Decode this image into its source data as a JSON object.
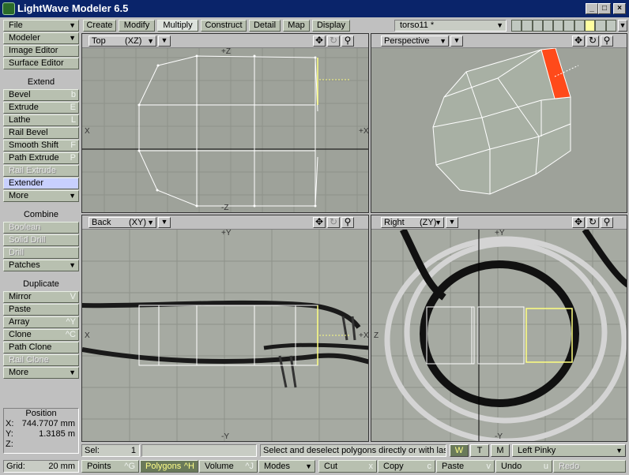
{
  "window": {
    "title": "LightWave Modeler 6.5",
    "min": "_",
    "max": "□",
    "close": "×"
  },
  "tabs": [
    "Create",
    "Modify",
    "Multiply",
    "Construct",
    "Detail",
    "Map",
    "Display"
  ],
  "object_name": "torso11 *",
  "sidebar": {
    "menus": [
      {
        "label": "File"
      },
      {
        "label": "Modeler"
      },
      {
        "label": "Image Editor"
      },
      {
        "label": "Surface Editor"
      }
    ],
    "extend_header": "Extend",
    "extend": [
      {
        "label": "Bevel",
        "shortcut": "b"
      },
      {
        "label": "Extrude",
        "shortcut": "E"
      },
      {
        "label": "Lathe",
        "shortcut": "L"
      },
      {
        "label": "Rail Bevel",
        "shortcut": ""
      },
      {
        "label": "Smooth Shift",
        "shortcut": "F"
      },
      {
        "label": "Path Extrude",
        "shortcut": "P"
      },
      {
        "label": "Rail Extrude",
        "shortcut": ""
      },
      {
        "label": "Extender",
        "shortcut": ""
      },
      {
        "label": "More",
        "shortcut": ""
      }
    ],
    "combine_header": "Combine",
    "combine": [
      {
        "label": "Boolean"
      },
      {
        "label": "Solid Drill"
      },
      {
        "label": "Drill"
      },
      {
        "label": "Patches"
      }
    ],
    "duplicate_header": "Duplicate",
    "duplicate": [
      {
        "label": "Mirror",
        "shortcut": "V"
      },
      {
        "label": "Paste",
        "shortcut": ""
      },
      {
        "label": "Array",
        "shortcut": "^Y"
      },
      {
        "label": "Clone",
        "shortcut": "^C"
      },
      {
        "label": "Path Clone",
        "shortcut": ""
      },
      {
        "label": "Rail Clone",
        "shortcut": ""
      },
      {
        "label": "More",
        "shortcut": ""
      }
    ],
    "position": {
      "label": "Position",
      "x_label": "X:",
      "x": "744.7707 mm",
      "y_label": "Y:",
      "y": "1.3185 m",
      "z_label": "Z:",
      "z": ""
    }
  },
  "viewports": {
    "top": {
      "view": "Top",
      "axes": "(XZ)",
      "axis_top": "+Z",
      "axis_bottom": "-Z",
      "axis_right": "+X",
      "axis_left": "X"
    },
    "perspective": {
      "view": "Perspective"
    },
    "back": {
      "view": "Back",
      "axes": "(XY)",
      "axis_top": "+Y",
      "axis_bottom": "-Y",
      "axis_right": "+X",
      "axis_left": "X"
    },
    "right": {
      "view": "Right",
      "axes": "(ZY)",
      "axis_top": "+Y",
      "axis_bottom": "-Y",
      "axis_left": "Z"
    }
  },
  "status": {
    "sel_label": "Sel:",
    "sel_count": "1",
    "hint": "Select and deselect polygons directly or with las...",
    "w": "W",
    "t": "T",
    "m": "M",
    "layer": "Left Pinky"
  },
  "bottom": {
    "grid_label": "Grid:",
    "grid_value": "20 mm",
    "points": "Points",
    "points_sc": "^G",
    "polygons": "Polygons",
    "polygons_sc": "^H",
    "volume": "Volume",
    "volume_sc": "^J",
    "modes": "Modes",
    "cut": "Cut",
    "cut_sc": "x",
    "copy": "Copy",
    "copy_sc": "c",
    "paste": "Paste",
    "paste_sc": "v",
    "undo": "Undo",
    "undo_sc": "u",
    "redo": "Redo"
  },
  "colors": {
    "accent": "#0a246a",
    "selection": "#ff4a1a",
    "viewport_bg": "#9ea29a",
    "wire": "#ffffff",
    "selected_wire": "#ffff80"
  }
}
